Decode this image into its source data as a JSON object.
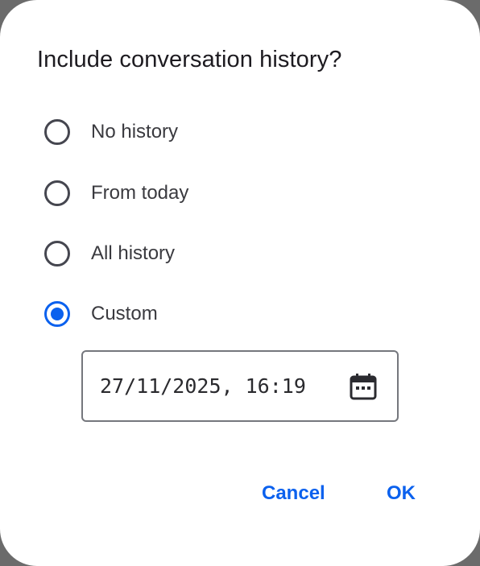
{
  "dialog": {
    "title": "Include conversation history?",
    "options": [
      {
        "label": "No history",
        "selected": false
      },
      {
        "label": "From today",
        "selected": false
      },
      {
        "label": "All history",
        "selected": false
      },
      {
        "label": "Custom",
        "selected": true
      }
    ],
    "datetime_value": "27/11/2025, 16:19",
    "datetime_icon": "calendar-icon",
    "cancel_label": "Cancel",
    "ok_label": "OK"
  },
  "colors": {
    "accent": "#0b61ee",
    "background": "#ffffff",
    "text": "#1d1b20",
    "radio_unselected": "#45464f",
    "field_border": "#75777d"
  }
}
